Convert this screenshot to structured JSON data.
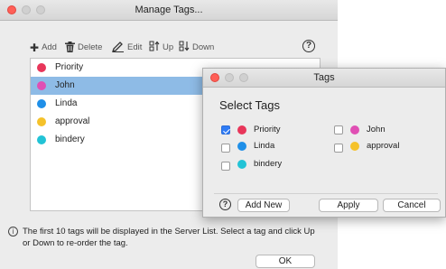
{
  "main_window": {
    "title": "Manage Tags...",
    "toolbar": {
      "add": "Add",
      "delete": "Delete",
      "edit": "Edit",
      "up": "Up",
      "down": "Down"
    },
    "tags": [
      {
        "name": "Priority",
        "color": "#e8365a",
        "selected": false
      },
      {
        "name": "John",
        "color": "#e04fb4",
        "selected": true
      },
      {
        "name": "Linda",
        "color": "#1f8fe8",
        "selected": false
      },
      {
        "name": "approval",
        "color": "#f5c22b",
        "selected": false
      },
      {
        "name": "bindery",
        "color": "#22c3d6",
        "selected": false
      }
    ],
    "info_text": "The first 10 tags will be displayed in the Server List. Select a tag and click Up or Down to re-order the tag.",
    "ok_label": "OK"
  },
  "dialog": {
    "title": "Tags",
    "heading": "Select Tags",
    "options": [
      {
        "name": "Priority",
        "color": "#e8365a",
        "checked": true
      },
      {
        "name": "John",
        "color": "#e04fb4",
        "checked": false
      },
      {
        "name": "Linda",
        "color": "#1f8fe8",
        "checked": false
      },
      {
        "name": "approval",
        "color": "#f5c22b",
        "checked": false
      },
      {
        "name": "bindery",
        "color": "#22c3d6",
        "checked": false
      }
    ],
    "add_new_label": "Add New",
    "apply_label": "Apply",
    "cancel_label": "Cancel"
  },
  "icons": {
    "close": "close-icon",
    "help": "help-icon",
    "info": "info-icon",
    "add": "plus-icon",
    "delete": "trash-icon",
    "edit": "pencil-icon",
    "up": "sort-up-icon",
    "down": "sort-down-icon"
  },
  "colors": {
    "selection": "#8ebbe6",
    "checkbox_on": "#2f7cf6"
  }
}
